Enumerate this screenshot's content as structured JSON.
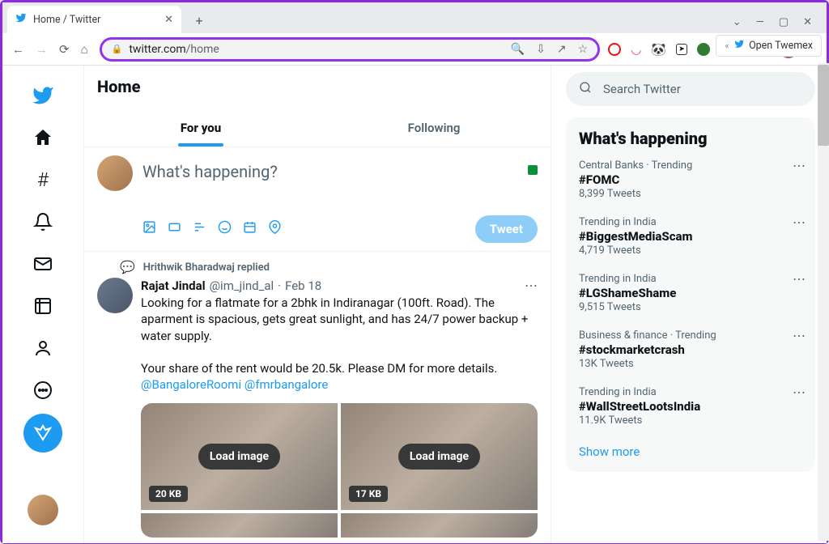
{
  "browser": {
    "tab_title": "Home / Twitter",
    "url_host": "twitter.com",
    "url_path": "/home",
    "twemex_label": "Open Twemex"
  },
  "header": {
    "title": "Home"
  },
  "tabs": {
    "for_you": "For you",
    "following": "Following"
  },
  "composer": {
    "placeholder": "What's happening?",
    "tweet_btn": "Tweet"
  },
  "social_context": "Hrithwik Bharadwaj replied",
  "post": {
    "name": "Rajat Jindal",
    "handle": "@im_jind_al",
    "sep": "·",
    "date": "Feb 18",
    "body1": "Looking for a flatmate for a 2bhk in Indiranagar (100ft. Road). The aparment is spacious, gets great sunlight, and has 24/7 power backup + water supply.",
    "body2": "Your share of the rent would be 20.5k. Please DM for more details.",
    "mention1": "@BangaloreRoomi",
    "mention2": "@fmrbangalore",
    "load_label": "Load image",
    "size1": "20 KB",
    "size2": "17 KB"
  },
  "search_placeholder": "Search Twitter",
  "trends_title": "What's happening",
  "trends": [
    {
      "ctx": "Central Banks · Trending",
      "tag": "#FOMC",
      "cnt": "8,399 Tweets"
    },
    {
      "ctx": "Trending in India",
      "tag": "#BiggestMediaScam",
      "cnt": "4,719 Tweets"
    },
    {
      "ctx": "Trending in India",
      "tag": "#LGShameShame",
      "cnt": "9,515 Tweets"
    },
    {
      "ctx": "Business & finance · Trending",
      "tag": "#stockmarketcrash",
      "cnt": "13K Tweets"
    },
    {
      "ctx": "Trending in India",
      "tag": "#WallStreetLootsIndia",
      "cnt": "11.9K Tweets"
    }
  ],
  "show_more": "Show more"
}
